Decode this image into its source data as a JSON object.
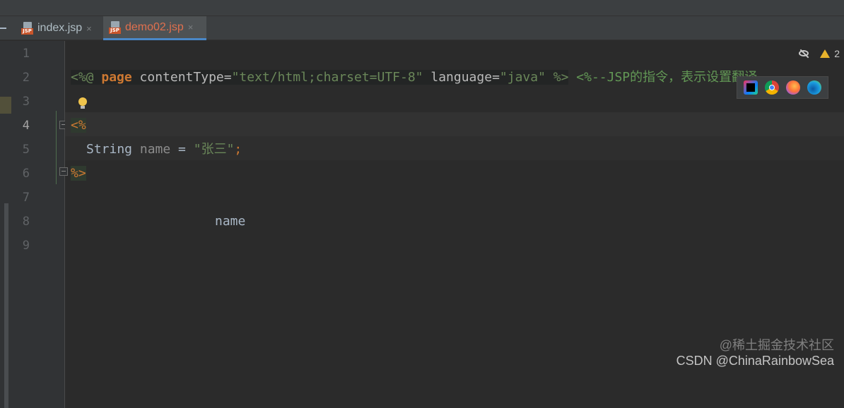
{
  "tabs": [
    {
      "label": "index.jsp",
      "close": "×",
      "active": false
    },
    {
      "label": "demo02.jsp",
      "close": "×",
      "active": true
    }
  ],
  "icons": {
    "file_badge_text": "JSP"
  },
  "inspection": {
    "warning_count": "2"
  },
  "line_numbers": [
    "1",
    "2",
    "3",
    "4",
    "5",
    "6",
    "7",
    "8",
    "9"
  ],
  "current_line": "4",
  "code": {
    "line2": {
      "open": "<%@",
      "directive": " page",
      "attr1": " contentType=",
      "val1": "\"text/html;charset=UTF-8\"",
      "attr2": " language=",
      "val2": "\"java\"",
      "close": " %>",
      "comment": " <%--JSP的指令，表示设置翻译"
    },
    "line4": "<%",
    "line5": {
      "type": "String",
      "var": " name",
      "eq": " = ",
      "str": "\"张三\"",
      "semi": ";"
    },
    "line6": "%>",
    "line8": "name"
  },
  "browser_icons": [
    "intellij-icon",
    "chrome-icon",
    "firefox-icon",
    "edge-icon"
  ],
  "watermark": {
    "line1": "@稀土掘金技术社区",
    "line2": "CSDN @ChinaRainbowSea"
  },
  "colors": {
    "background": "#2b2b2b",
    "gutter": "#313335",
    "active_tab_underline": "#4a88c7",
    "active_tab_text": "#e0704e",
    "keyword": "#cc7832",
    "string": "#6a8759"
  }
}
